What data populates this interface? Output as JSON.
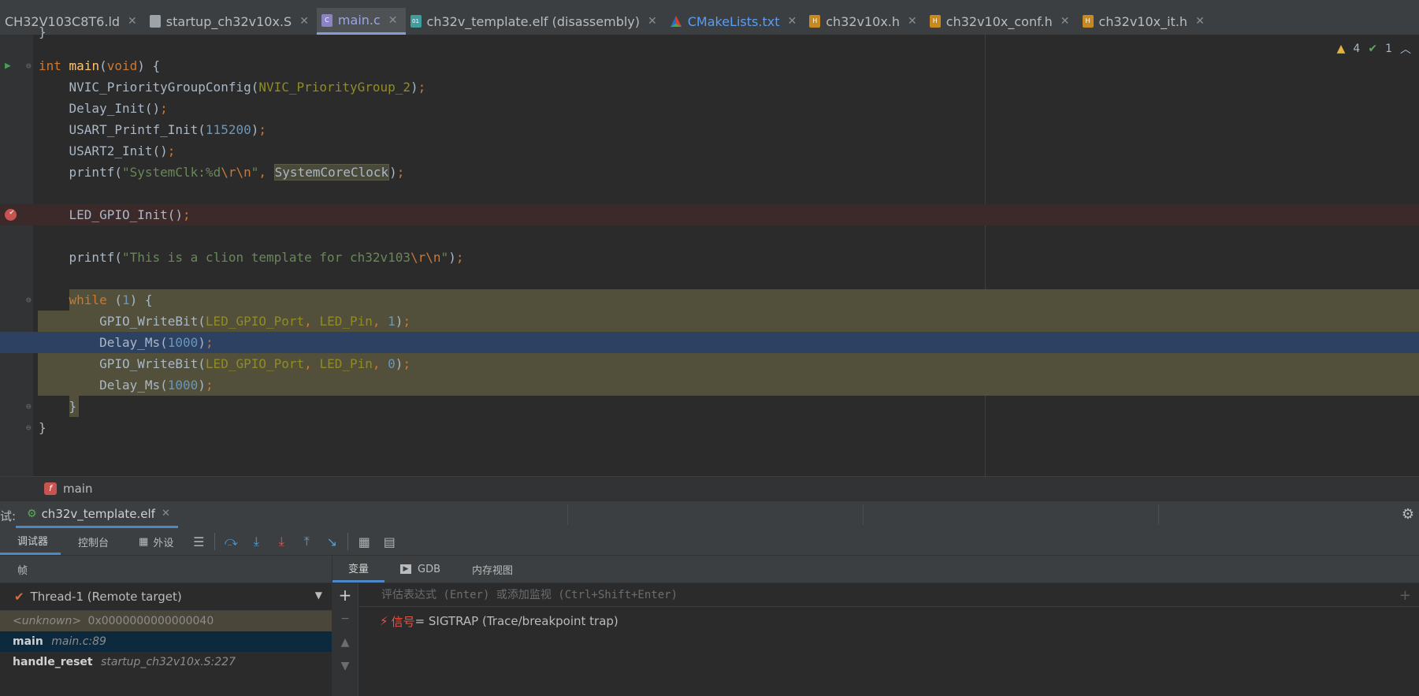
{
  "tabs": [
    {
      "label": "CH32V103C8T6.ld",
      "icon": "linker-script-icon",
      "type": "ld"
    },
    {
      "label": "startup_ch32v10x.S",
      "icon": "asm-file-icon",
      "type": "asm"
    },
    {
      "label": "main.c",
      "icon": "c-file-icon",
      "type": "c",
      "active": true
    },
    {
      "label": "ch32v_template.elf (disassembly)",
      "icon": "disassembly-file-icon",
      "type": "elf"
    },
    {
      "label": "CMakeLists.txt",
      "icon": "cmake-icon",
      "type": "cmake"
    },
    {
      "label": "ch32v10x.h",
      "icon": "header-file-icon",
      "type": "h"
    },
    {
      "label": "ch32v10x_conf.h",
      "icon": "header-file-icon",
      "type": "h"
    },
    {
      "label": "ch32v10x_it.h",
      "icon": "header-file-icon",
      "type": "h"
    }
  ],
  "inspection": {
    "warnings": "4",
    "ok": "1"
  },
  "code_lines": [
    "}",
    "",
    "int main(void) {",
    "    NVIC_PriorityGroupConfig(NVIC_PriorityGroup_2);",
    "    Delay_Init();",
    "    USART_Printf_Init(115200);",
    "    USART2_Init();",
    "    printf(\"SystemClk:%d\\r\\n\", SystemCoreClock);",
    "",
    "    LED_GPIO_Init();",
    "",
    "    printf(\"This is a clion template for ch32v103\\r\\n\");",
    "",
    "    while (1) {",
    "        GPIO_WriteBit(LED_GPIO_Port, LED_Pin, 1);",
    "        Delay_Ms(1000);",
    "        GPIO_WriteBit(LED_GPIO_Port, LED_Pin, 0);",
    "        Delay_Ms(1000);",
    "    }",
    "}"
  ],
  "breadcrumb": {
    "badge": "f",
    "label": "main"
  },
  "debug": {
    "prefix": "试:",
    "run_tab": "ch32v_template.elf",
    "toolbar_tabs": [
      "调试器",
      "控制台",
      "外设"
    ],
    "frames_header": "帧",
    "thread": "Thread-1 (Remote target)",
    "frames": [
      {
        "name": "<unknown>",
        "loc": "0x0000000000000040",
        "kind": "unknown"
      },
      {
        "name": "main",
        "loc": "main.c:89",
        "kind": "selected"
      },
      {
        "name": "handle_reset",
        "loc": "startup_ch32v10x.S:227",
        "kind": "normal"
      }
    ],
    "var_tabs": [
      "变量",
      "GDB",
      "内存视图"
    ],
    "eval_placeholder": "评估表达式 (Enter) 或添加监视 (Ctrl+Shift+Enter)",
    "signal": {
      "name": "信号",
      "value": " = SIGTRAP (Trace/breakpoint trap)"
    }
  }
}
